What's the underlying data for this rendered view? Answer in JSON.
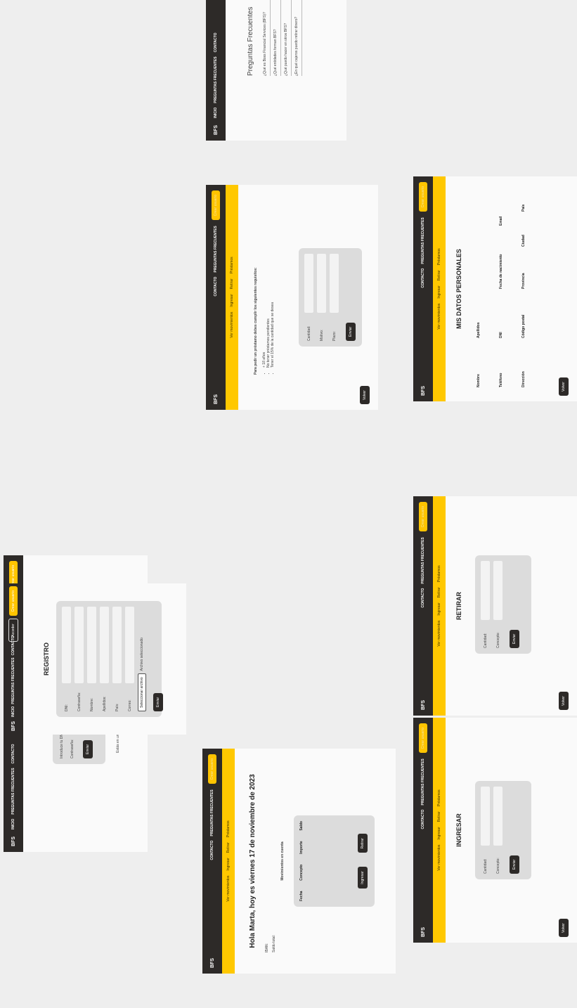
{
  "common": {
    "brand": "BFS",
    "nav_inicio": "INICIO",
    "nav_faq": "PREGUNTAS FRECUENTES",
    "nav_contacto": "CONTACTO",
    "btn_acceder": "Acceder",
    "btn_crear_usuario": "Crear usuario",
    "sub_ver_movimientos": "Ver movimientos",
    "sub_ingresar": "Ingresar",
    "sub_retirar": "Retirar",
    "sub_prestamos": "Préstamos",
    "btn_enviar": "Enviar",
    "btn_volver": "Volver",
    "lbl_cantidad": "Cantidad:",
    "lbl_concepto": "Concepto:"
  },
  "login": {
    "heading": "Hola, introduce tus datos de acceso:",
    "dni_label": "Introduce tu DNI:",
    "password_label": "Contraseña:",
    "footer_note": "Estás en un entorno seguro con Boss Financial Services (BFS)"
  },
  "registro": {
    "title": "REGISTRO",
    "fields": [
      "DNI:",
      "Contraseña:",
      "Nombre:",
      "Apellidos:",
      "País:",
      "Correo:"
    ],
    "file_button": "Seleccionar archivo",
    "file_status": "Archivo seleccionado"
  },
  "dashboard": {
    "greeting": "Hola Marta, hoy es viernes 17 de noviembre de 2023",
    "iban_label": "IBAN:",
    "saldo_label": "Saldo total:",
    "movements_title": "Movimientos en cuenta",
    "columns": [
      "Fecha",
      "Concepto",
      "Importe",
      "Saldo"
    ],
    "btn_ingresar": "Ingresar",
    "btn_retirar": "Retirar"
  },
  "ingresar": {
    "title": "INGRESAR"
  },
  "retirar": {
    "title": "RETIRAR"
  },
  "prestamos": {
    "intro": "Para pedir un préstamo debes cumplir los siguientes requisitos:",
    "requirements": [
      "+ 18 años",
      "No tener préstamos pendientes",
      "Tener el 15% de la cantidad que se desea"
    ],
    "lbl_motivo": "Motivo:",
    "lbl_plazo": "Plazo:"
  },
  "datos": {
    "title": "MIS DATOS PERSONALES",
    "rows": [
      [
        "Nombre",
        "Apellidos",
        "",
        ""
      ],
      [
        "Teléfono",
        "DNI",
        "Fecha de nacimiento",
        "Email"
      ],
      [
        "Dirección",
        "Código postal",
        "Provincia",
        "Ciudad",
        "País"
      ]
    ]
  },
  "faq": {
    "title": "Preguntas Frecuentes",
    "questions": [
      "¿Qué es Boss Financial Services (BFS)?",
      "¿Qué entidades forman BFS?",
      "¿Qué puedo hacer en otros BFS?",
      "¿En qué cajeros puedo retirar dinero?"
    ]
  }
}
